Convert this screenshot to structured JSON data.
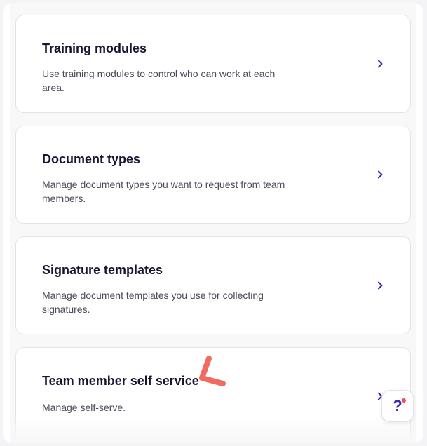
{
  "settings_cards": [
    {
      "title": "Training modules",
      "description": "Use training modules to control who can work at each area."
    },
    {
      "title": "Document types",
      "description": "Manage document types you want to request from team members."
    },
    {
      "title": "Signature templates",
      "description": "Manage document templates you use for collecting signatures."
    },
    {
      "title": "Team member self service",
      "description": "Manage self-serve."
    }
  ],
  "help": {
    "label": "?",
    "icon": "help-question-icon"
  },
  "icons": {
    "chevron": "chevron-right-icon",
    "annotation": "annotation-arrow-icon"
  },
  "colors": {
    "title": "#171632",
    "description": "#4a4a5a",
    "chevron": "#3b2bb4",
    "notification_dot": "#ef4f5c",
    "annotation_arrow": "#f26b63"
  }
}
